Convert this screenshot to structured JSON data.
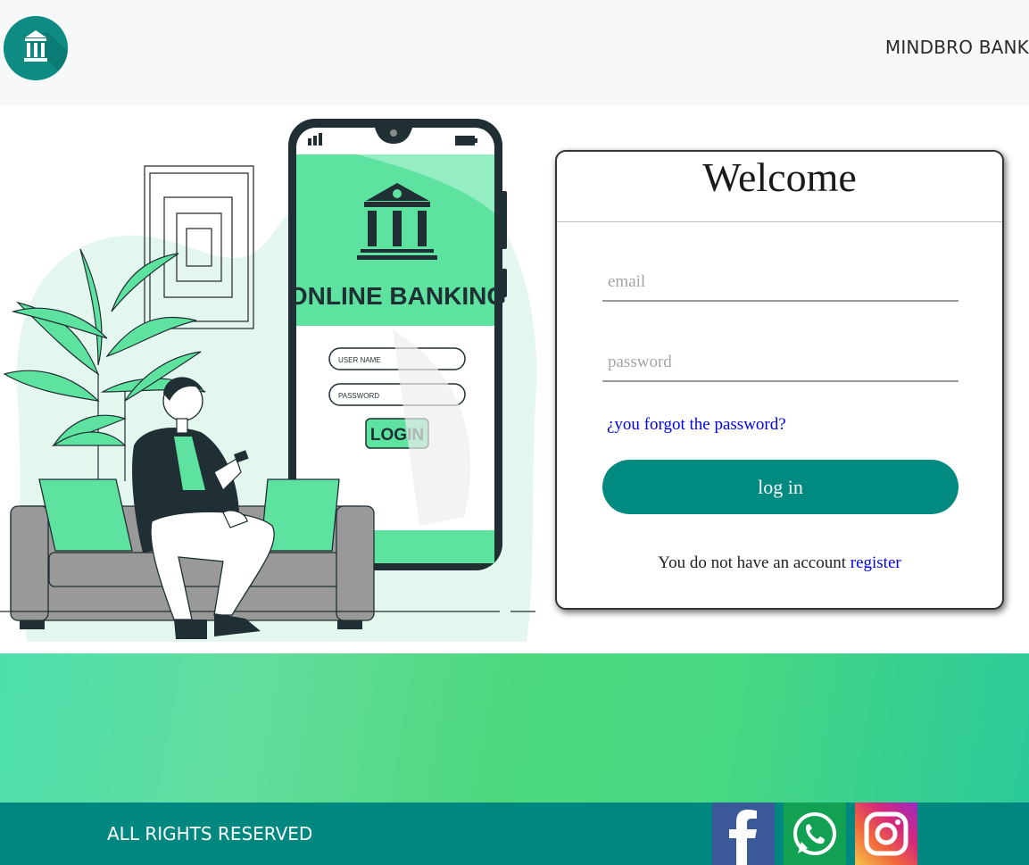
{
  "header": {
    "brand": "MINDBRO BANK",
    "logo_icon": "bank-icon"
  },
  "illustration": {
    "screen_title": "ONLINE BANKING",
    "username_placeholder": "USER NAME",
    "password_placeholder": "PASSWORD",
    "login_label": "LOGIN"
  },
  "login": {
    "title": "Welcome",
    "email_placeholder": "email",
    "password_placeholder": "password",
    "forgot_link": "¿you forgot the password?",
    "submit_label": "log in",
    "no_account_text": "You do not have an account",
    "register_link": "register"
  },
  "footer": {
    "rights": "ALL RIGHTS RESERVED",
    "social": [
      {
        "name": "facebook",
        "icon": "facebook-icon"
      },
      {
        "name": "whatsapp",
        "icon": "whatsapp-icon"
      },
      {
        "name": "instagram",
        "icon": "instagram-icon"
      }
    ]
  },
  "colors": {
    "brand_teal": "#008a80",
    "accent_green": "#5ee2a0",
    "link_blue": "#0000ee"
  }
}
